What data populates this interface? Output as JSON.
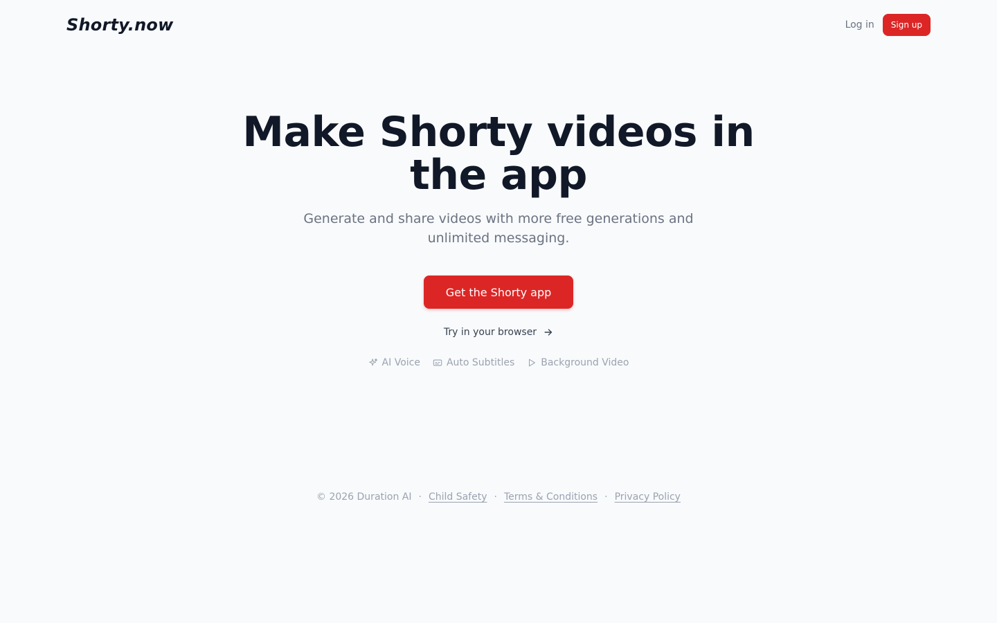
{
  "header": {
    "logo": "Shorty.now",
    "login_label": "Log in",
    "signup_label": "Sign up"
  },
  "hero": {
    "title": "Make Shorty videos in the app",
    "subtitle": "Generate and share videos with more free generations and unlimited messaging.",
    "cta_label": "Get the Shorty app",
    "browser_link_label": "Try in your browser"
  },
  "features": [
    {
      "label": "AI Voice",
      "icon": "sparkle-icon"
    },
    {
      "label": "Auto Subtitles",
      "icon": "subtitles-icon"
    },
    {
      "label": "Background Video",
      "icon": "play-icon"
    }
  ],
  "footer": {
    "copyright": "© 2026 Duration AI",
    "separator": "·",
    "links": [
      {
        "label": "Child Safety"
      },
      {
        "label": "Terms & Conditions"
      },
      {
        "label": "Privacy Policy"
      }
    ]
  },
  "colors": {
    "accent": "#dc2626",
    "background": "#f8fafc",
    "heading": "#111827",
    "muted": "#6b7280",
    "subtle": "#9ca3af"
  }
}
